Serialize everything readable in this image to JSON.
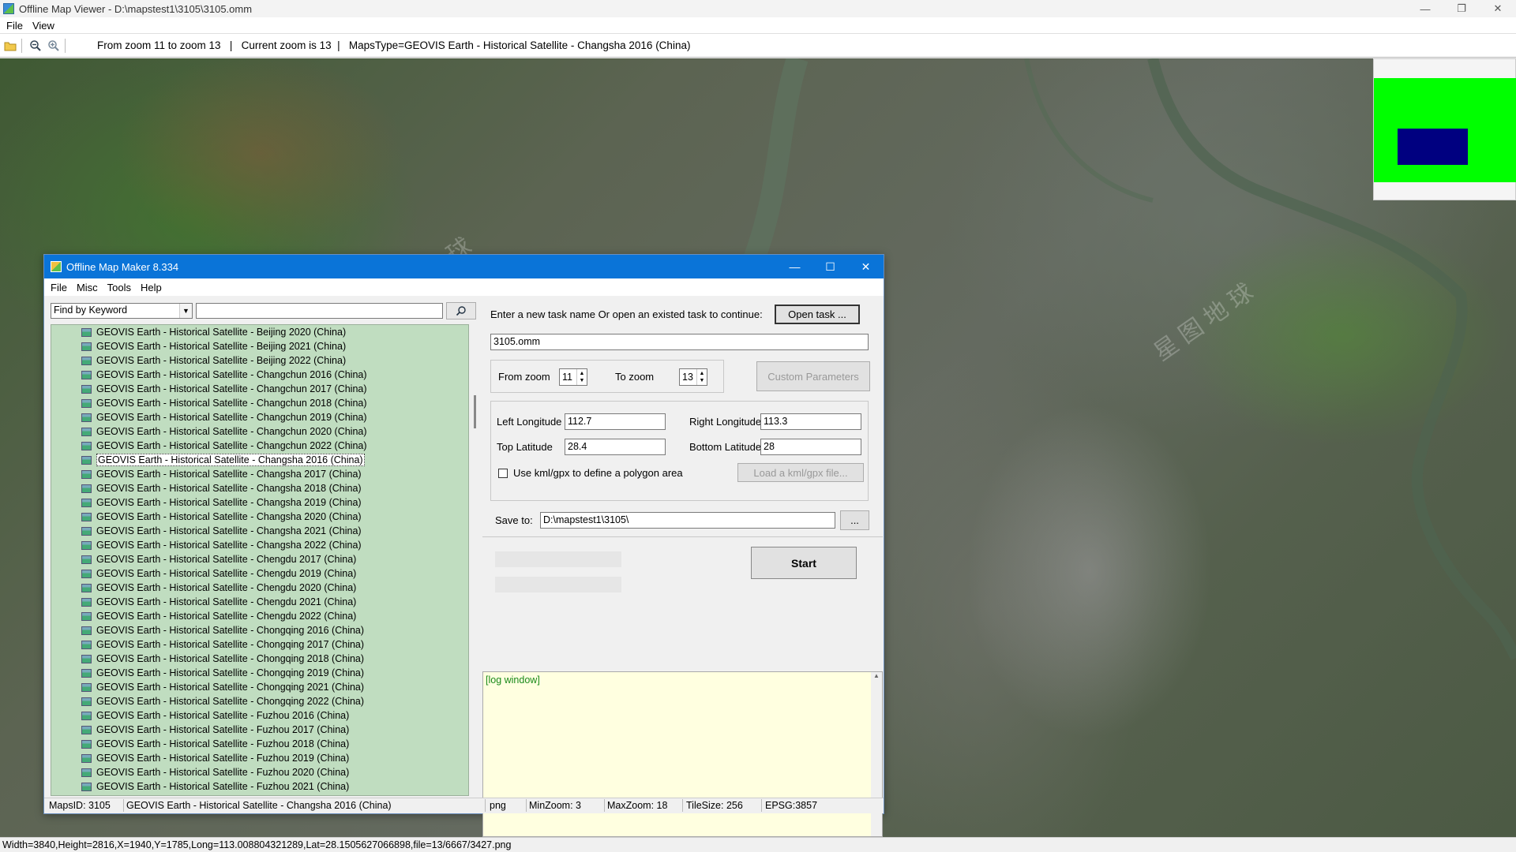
{
  "outer": {
    "title": "Offline Map Viewer - D:\\mapstest1\\3105\\3105.omm",
    "menu": [
      "File",
      "View"
    ],
    "controls": {
      "minimize": "—",
      "restore": "❐",
      "close": "✕"
    },
    "zoom_info": "From zoom 11 to zoom 13   |   Current zoom is 13  |   MapsType=GEOVIS Earth - Historical Satellite - Changsha 2016 (China)",
    "status": "Width=3840,Height=2816,X=1940,Y=1785,Long=113.008804321289,Lat=28.1505627066898,file=13/6667/3427.png"
  },
  "dialog": {
    "title": "Offline Map Maker 8.334",
    "menu": [
      "File",
      "Misc",
      "Tools",
      "Help"
    ],
    "controls": {
      "minimize": "—",
      "maximize": "☐",
      "close": "✕"
    },
    "find_mode": "Find by Keyword",
    "search_value": "",
    "map_list": [
      "GEOVIS Earth - Historical Satellite - Beijing 2020 (China)",
      "GEOVIS Earth - Historical Satellite - Beijing 2021 (China)",
      "GEOVIS Earth - Historical Satellite - Beijing 2022 (China)",
      "GEOVIS Earth - Historical Satellite - Changchun 2016 (China)",
      "GEOVIS Earth - Historical Satellite - Changchun 2017 (China)",
      "GEOVIS Earth - Historical Satellite - Changchun 2018 (China)",
      "GEOVIS Earth - Historical Satellite - Changchun 2019 (China)",
      "GEOVIS Earth - Historical Satellite - Changchun 2020 (China)",
      "GEOVIS Earth - Historical Satellite - Changchun 2022 (China)",
      "GEOVIS Earth - Historical Satellite - Changsha 2016 (China)",
      "GEOVIS Earth - Historical Satellite - Changsha 2017 (China)",
      "GEOVIS Earth - Historical Satellite - Changsha 2018 (China)",
      "GEOVIS Earth - Historical Satellite - Changsha 2019 (China)",
      "GEOVIS Earth - Historical Satellite - Changsha 2020 (China)",
      "GEOVIS Earth - Historical Satellite - Changsha 2021 (China)",
      "GEOVIS Earth - Historical Satellite - Changsha 2022 (China)",
      "GEOVIS Earth - Historical Satellite - Chengdu 2017 (China)",
      "GEOVIS Earth - Historical Satellite - Chengdu 2019 (China)",
      "GEOVIS Earth - Historical Satellite - Chengdu 2020 (China)",
      "GEOVIS Earth - Historical Satellite - Chengdu 2021 (China)",
      "GEOVIS Earth - Historical Satellite - Chengdu 2022 (China)",
      "GEOVIS Earth - Historical Satellite - Chongqing 2016 (China)",
      "GEOVIS Earth - Historical Satellite - Chongqing 2017 (China)",
      "GEOVIS Earth - Historical Satellite - Chongqing 2018 (China)",
      "GEOVIS Earth - Historical Satellite - Chongqing 2019 (China)",
      "GEOVIS Earth - Historical Satellite - Chongqing 2021 (China)",
      "GEOVIS Earth - Historical Satellite - Chongqing 2022 (China)",
      "GEOVIS Earth - Historical Satellite - Fuzhou 2016 (China)",
      "GEOVIS Earth - Historical Satellite - Fuzhou 2017 (China)",
      "GEOVIS Earth - Historical Satellite - Fuzhou 2018 (China)",
      "GEOVIS Earth - Historical Satellite - Fuzhou 2019 (China)",
      "GEOVIS Earth - Historical Satellite - Fuzhou 2020 (China)",
      "GEOVIS Earth - Historical Satellite - Fuzhou 2021 (China)"
    ],
    "selected_index": 9,
    "task_prompt": "Enter a new task name Or open an existed task to continue:",
    "open_task_label": "Open task ...",
    "task_name": "3105.omm",
    "from_zoom_label": "From zoom",
    "from_zoom": "11",
    "to_zoom_label": "To zoom",
    "to_zoom": "13",
    "custom_params_label": "Custom Parameters",
    "left_lon_label": "Left Longitude",
    "left_lon": "112.7",
    "right_lon_label": "Right Longitude",
    "right_lon": "113.3",
    "top_lat_label": "Top Latitude",
    "top_lat": "28.4",
    "bottom_lat_label": "Bottom Latitude",
    "bottom_lat": "28",
    "kml_label": "Use kml/gpx to define a polygon area",
    "load_kml_label": "Load a kml/gpx file...",
    "save_to_label": "Save to:",
    "save_to": "D:\\mapstest1\\3105\\",
    "browse_label": "...",
    "start_label": "Start",
    "log_text": "[log window]",
    "status": {
      "maps_id": "MapsID: 3105",
      "map_name": "GEOVIS Earth - Historical Satellite - Changsha 2016 (China)",
      "format": "png",
      "min_zoom": "MinZoom: 3",
      "max_zoom": "MaxZoom: 18",
      "tile_size": "TileSize: 256",
      "epsg": "EPSG:3857"
    }
  },
  "colors": {
    "dialog_title_bg": "#0a74d8",
    "list_bg": "#c0ddc0",
    "log_bg": "#ffffe0",
    "log_text": "#1a8a1a",
    "overview_green": "#00ff00",
    "overview_blue": "#000080"
  }
}
